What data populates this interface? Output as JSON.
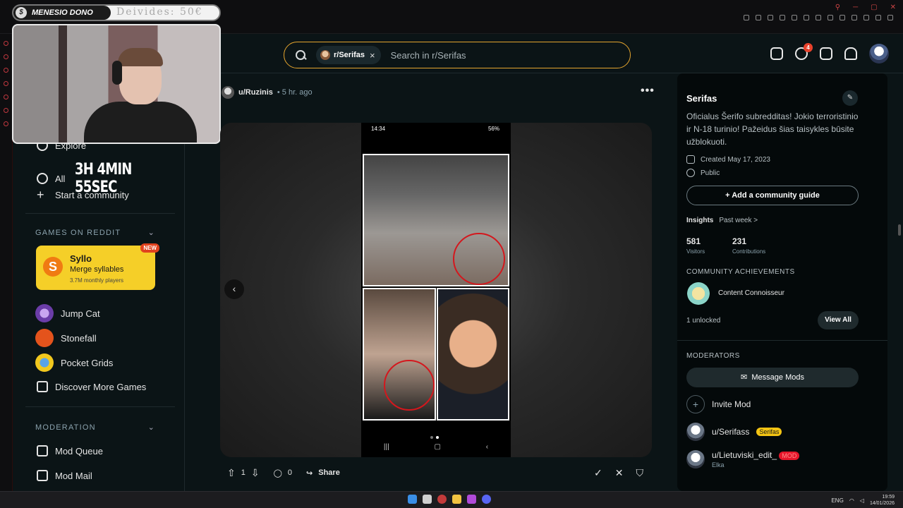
{
  "search": {
    "chip": "r/Serifas",
    "placeholder": "Search in r/Serifas",
    "chat_count": "4"
  },
  "overlay": {
    "streamer": "MENESIO DONO",
    "donations": "Deivides: 50€"
  },
  "sidebar": {
    "explore": "Explore",
    "all": "All",
    "timer": "3H 4MIN 55SEC",
    "start_community": "Start a community",
    "games_heading": "GAMES ON REDDIT",
    "featured_game": {
      "title": "Syllo",
      "subtitle": "Merge syllables",
      "players": "3.7M monthly players",
      "badge": "NEW",
      "logo": "S"
    },
    "games": [
      "Jump Cat",
      "Stonefall",
      "Pocket Grids",
      "Discover More Games"
    ],
    "moderation_heading": "MODERATION",
    "mod_items": [
      "Mod Queue",
      "Mod Mail"
    ]
  },
  "post": {
    "author": "u/Ruzinis",
    "time": "• 5 hr. ago",
    "phone_time": "14:34",
    "phone_battery": "56%",
    "votes": "1",
    "comments": "0",
    "share": "Share"
  },
  "community": {
    "name": "Serifas",
    "description": "Oficialus Šerifo subredditas! Jokio terroristinio ir N-18 turinio! Pažeidus šias taisykles būsite užblokuoti.",
    "created": "Created May 17, 2023",
    "visibility": "Public",
    "guide_button": "+ Add a community guide",
    "insights_label": "Insights",
    "insights_period": "Past week >",
    "visitors": "581",
    "visitors_label": "Visitors",
    "contributions": "231",
    "contributions_label": "Contributions",
    "achievements_heading": "COMMUNITY ACHIEVEMENTS",
    "achievement": "Content Connoisseur",
    "unlocked": "1 unlocked",
    "view_all": "View All",
    "moderators_heading": "MODERATORS",
    "message_mods": "Message Mods",
    "invite_mod": "Invite Mod",
    "mods": [
      {
        "name": "u/Serifass",
        "flair": "Serifas"
      },
      {
        "name": "u/Lietuviski_edit_",
        "flair": "MOD",
        "sub": "Elka"
      }
    ]
  },
  "taskbar": {
    "lang": "ENG",
    "time": "19:59",
    "date": "14/01/2026"
  }
}
